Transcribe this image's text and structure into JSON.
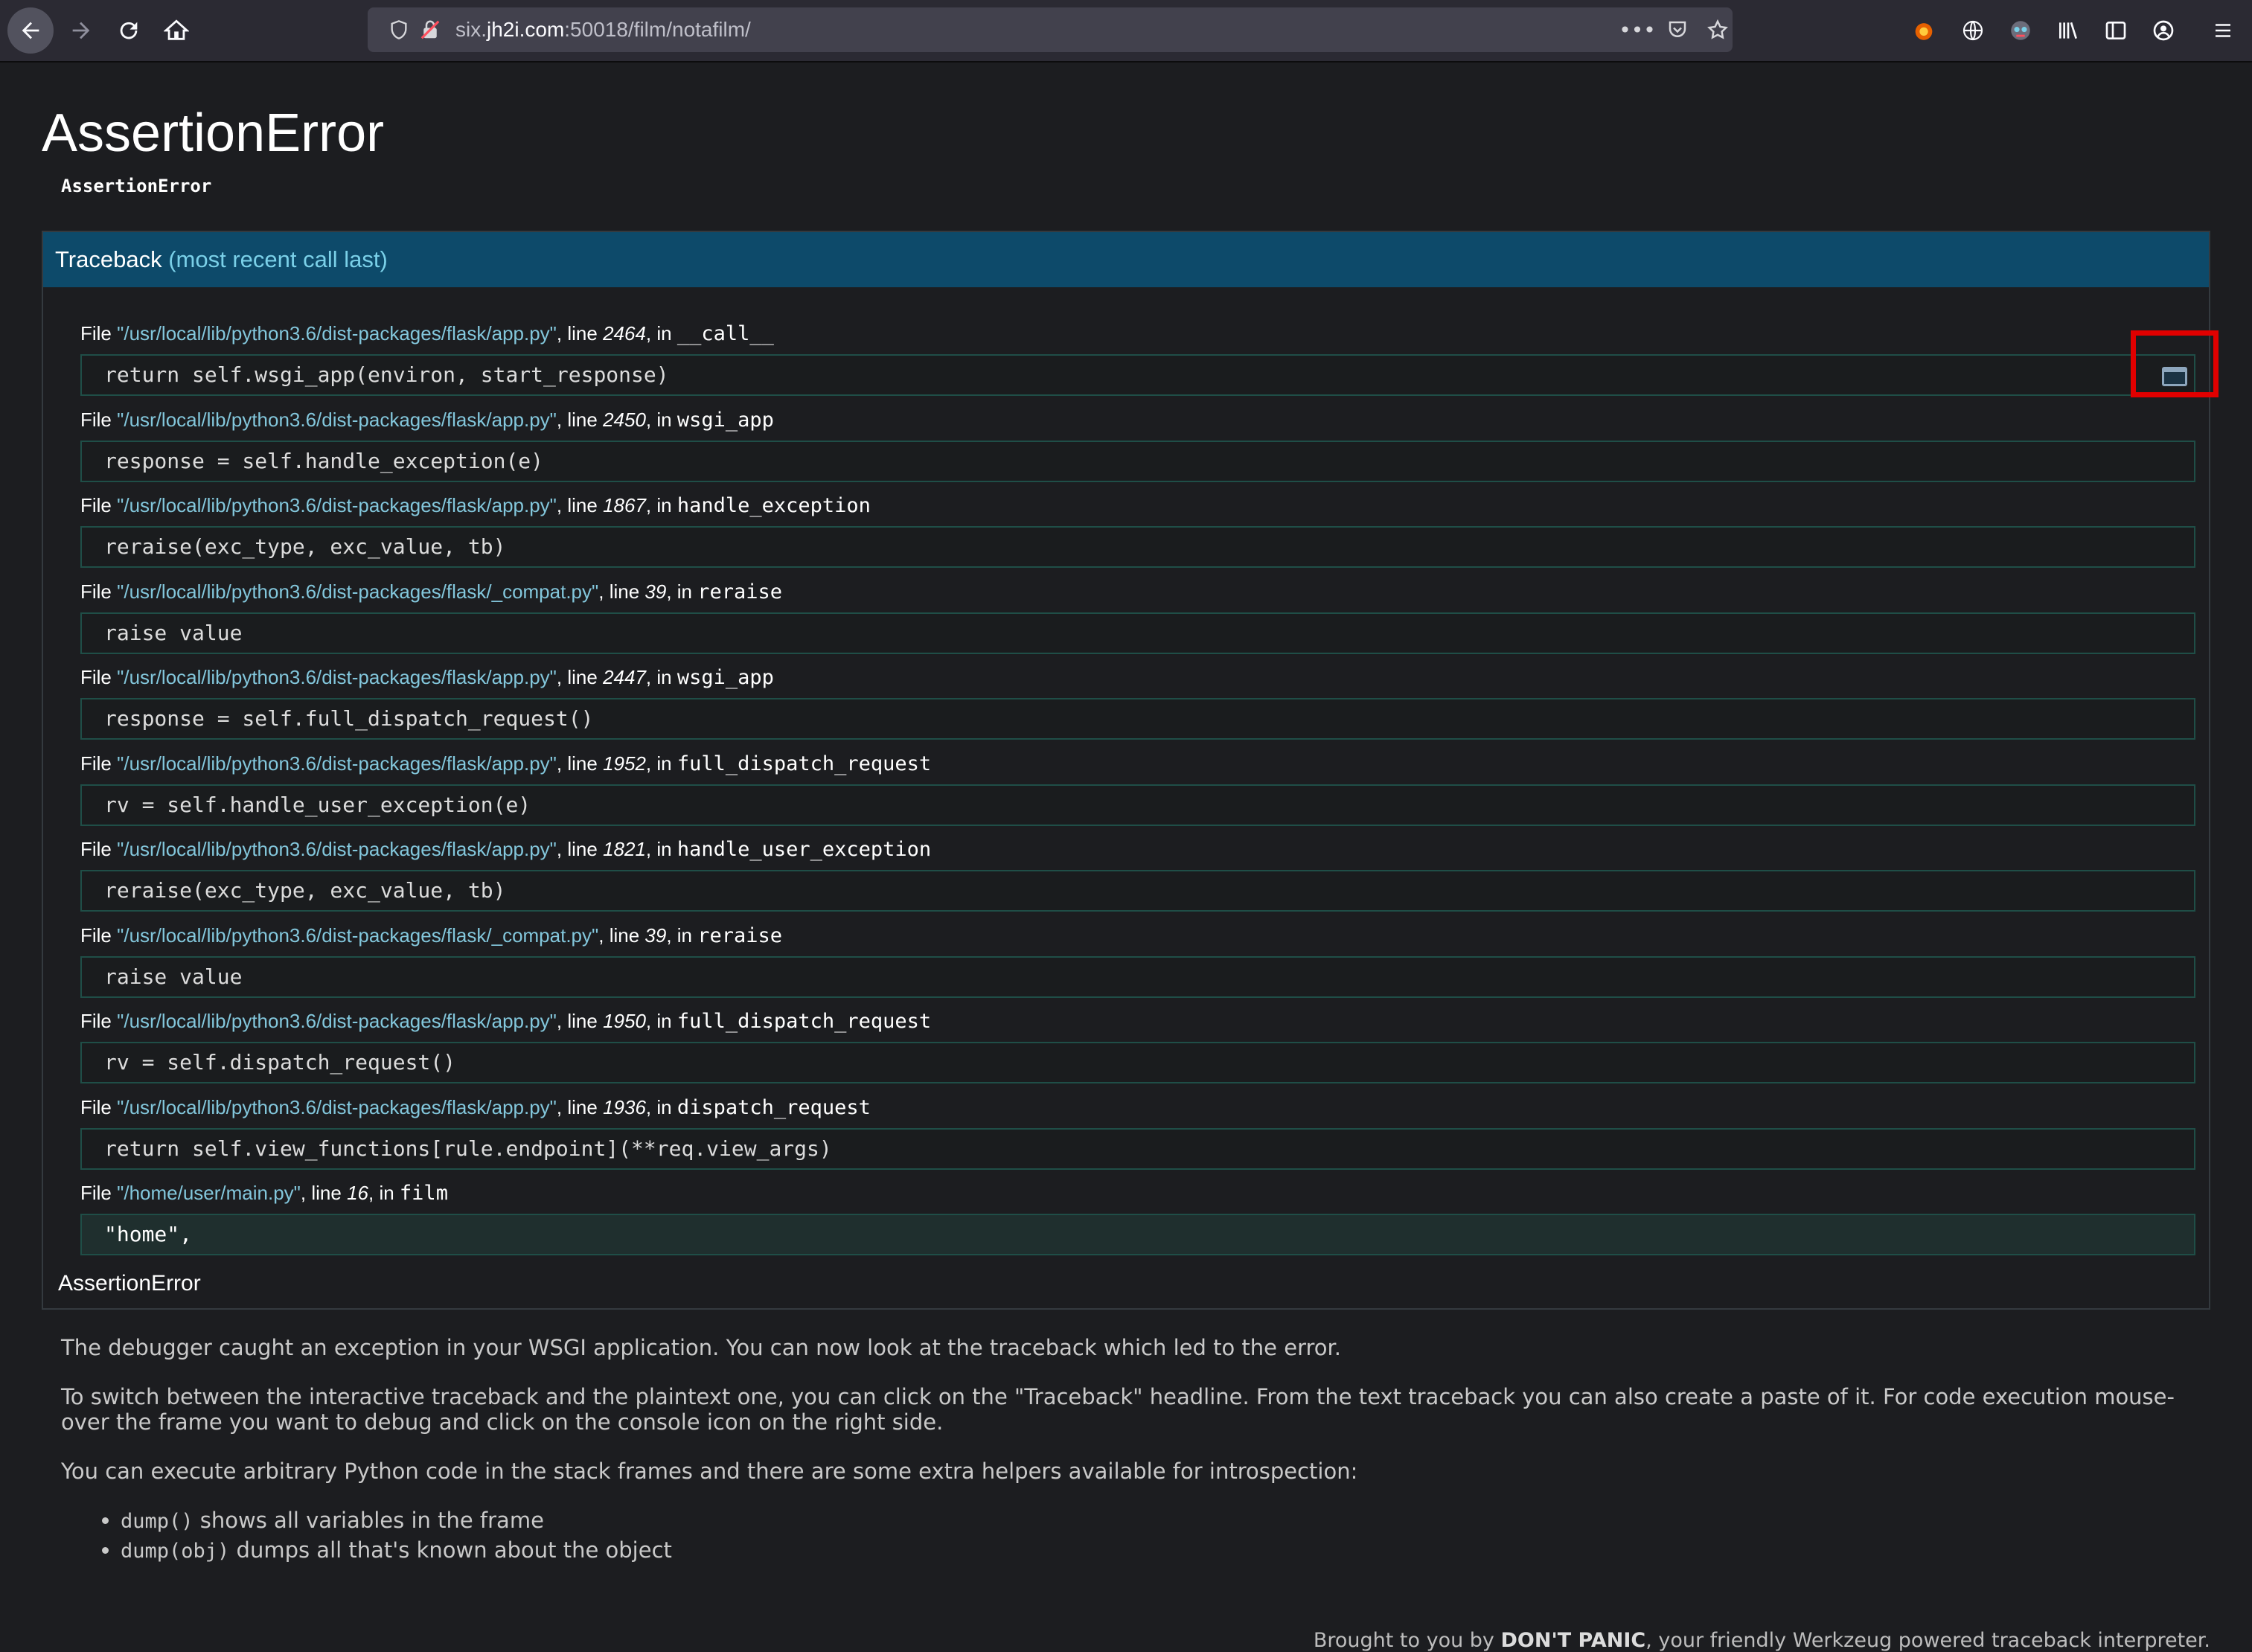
{
  "browser": {
    "url_prefix": "six.",
    "url_host": "jh2i.com",
    "url_rest": ":50018/film/notafilm/"
  },
  "page": {
    "title": "AssertionError",
    "error_message": "AssertionError",
    "traceback_title": "Traceback",
    "traceback_subtitle": "(most recent call last)",
    "exception_footer": "AssertionError"
  },
  "frames": [
    {
      "file": "\"/usr/local/lib/python3.6/dist-packages/flask/app.py\"",
      "line": "2464",
      "func": "__call__",
      "code": "return self.wsgi_app(environ, start_response)"
    },
    {
      "file": "\"/usr/local/lib/python3.6/dist-packages/flask/app.py\"",
      "line": "2450",
      "func": "wsgi_app",
      "code": "response = self.handle_exception(e)"
    },
    {
      "file": "\"/usr/local/lib/python3.6/dist-packages/flask/app.py\"",
      "line": "1867",
      "func": "handle_exception",
      "code": "reraise(exc_type, exc_value, tb)"
    },
    {
      "file": "\"/usr/local/lib/python3.6/dist-packages/flask/_compat.py\"",
      "line": "39",
      "func": "reraise",
      "code": "raise value"
    },
    {
      "file": "\"/usr/local/lib/python3.6/dist-packages/flask/app.py\"",
      "line": "2447",
      "func": "wsgi_app",
      "code": "response = self.full_dispatch_request()"
    },
    {
      "file": "\"/usr/local/lib/python3.6/dist-packages/flask/app.py\"",
      "line": "1952",
      "func": "full_dispatch_request",
      "code": "rv = self.handle_user_exception(e)"
    },
    {
      "file": "\"/usr/local/lib/python3.6/dist-packages/flask/app.py\"",
      "line": "1821",
      "func": "handle_user_exception",
      "code": "reraise(exc_type, exc_value, tb)"
    },
    {
      "file": "\"/usr/local/lib/python3.6/dist-packages/flask/_compat.py\"",
      "line": "39",
      "func": "reraise",
      "code": "raise value"
    },
    {
      "file": "\"/usr/local/lib/python3.6/dist-packages/flask/app.py\"",
      "line": "1950",
      "func": "full_dispatch_request",
      "code": "rv = self.dispatch_request()"
    },
    {
      "file": "\"/usr/local/lib/python3.6/dist-packages/flask/app.py\"",
      "line": "1936",
      "func": "dispatch_request",
      "code": "return self.view_functions[rule.endpoint](**req.view_args)"
    },
    {
      "file": "\"/home/user/main.py\"",
      "line": "16",
      "func": "film",
      "code": "\"home\",",
      "highlight": true
    }
  ],
  "text": {
    "file_word": "File ",
    "line_word": ", line ",
    "in_word": ", in "
  },
  "explanation": {
    "p1": "The debugger caught an exception in your WSGI application. You can now look at the traceback which led to the error.",
    "p2": "To switch between the interactive traceback and the plaintext one, you can click on the \"Traceback\" headline. From the text traceback you can also create a paste of it. For code execution mouse-over the frame you want to debug and click on the console icon on the right side.",
    "p3": "You can execute arbitrary Python code in the stack frames and there are some extra helpers available for introspection:",
    "helper1_code": "dump()",
    "helper1_text": " shows all variables in the frame",
    "helper2_code": "dump(obj)",
    "helper2_text": " dumps all that's known about the object"
  },
  "footer": {
    "prefix": "Brought to you by ",
    "brand": "DON'T PANIC",
    "suffix": ", your friendly Werkzeug powered traceback interpreter."
  }
}
